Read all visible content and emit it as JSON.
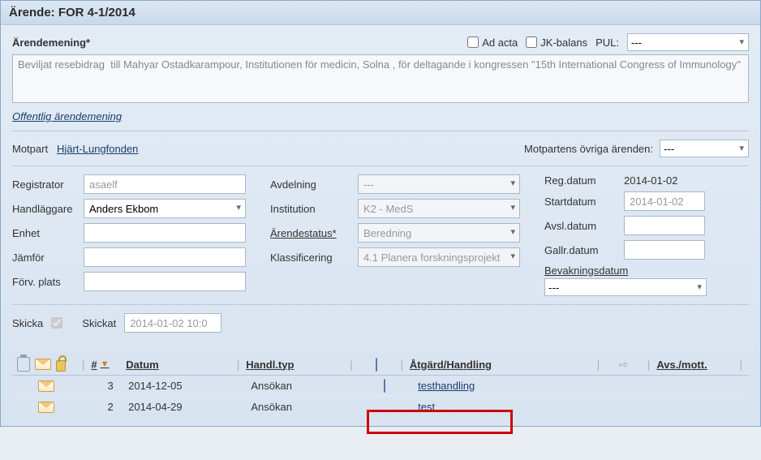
{
  "window": {
    "title": "Ärende: FOR 4-1/2014"
  },
  "top": {
    "arendemening_label": "Ärendemening*",
    "ad_acta_label": "Ad acta",
    "jk_balans_label": "JK-balans",
    "pul_label": "PUL:",
    "pul_value": "---",
    "description": "Beviljat resebidrag  till Mahyar Ostadkarampour, Institutionen för medicin, Solna , för deltagande i kongressen \"15th International Congress of Immunology\"",
    "offentlig_link": "Offentlig ärendemening"
  },
  "motpart": {
    "label": "Motpart",
    "value": "Hjärt-Lungfonden",
    "other_label": "Motpartens övriga ärenden:",
    "other_value": "---"
  },
  "left": {
    "registrator_label": "Registrator",
    "registrator_value": "asaelf",
    "handlaggare_label": "Handläggare",
    "handlaggare_value": "Anders Ekbom",
    "enhet_label": "Enhet",
    "enhet_value": "",
    "jamfor_label": "Jämför",
    "jamfor_value": "",
    "forv_label": "Förv. plats",
    "forv_value": ""
  },
  "mid": {
    "avdelning_label": "Avdelning",
    "avdelning_value": "---",
    "institution_label": "Institution",
    "institution_value": "K2 - MedS",
    "status_label": "Ärendestatus*",
    "status_value": "Beredning",
    "klass_label": "Klassificering",
    "klass_value": "4.1 Planera forskningsprojekt"
  },
  "right": {
    "reg_label": "Reg.datum",
    "reg_value": "2014-01-02",
    "start_label": "Startdatum",
    "start_value": "2014-01-02",
    "avsl_label": "Avsl.datum",
    "avsl_value": "",
    "gallr_label": "Gallr.datum",
    "gallr_value": "",
    "bevak_label": "Bevakningsdatum",
    "bevak_value": "---"
  },
  "skicka": {
    "label": "Skicka",
    "skickat_label": "Skickat",
    "skickat_value": "2014-01-02 10:0"
  },
  "table": {
    "headers": {
      "num": "#",
      "datum": "Datum",
      "handltyp": "Handl.typ",
      "atgard": "Åtgärd/Handling",
      "avs": "Avs./mott."
    },
    "rows": [
      {
        "num": "3",
        "datum": "2014-12-05",
        "typ": "Ansökan",
        "title": "testhandling",
        "has_doc": true
      },
      {
        "num": "2",
        "datum": "2014-04-29",
        "typ": "Ansökan",
        "title": "test",
        "has_doc": false
      }
    ]
  }
}
